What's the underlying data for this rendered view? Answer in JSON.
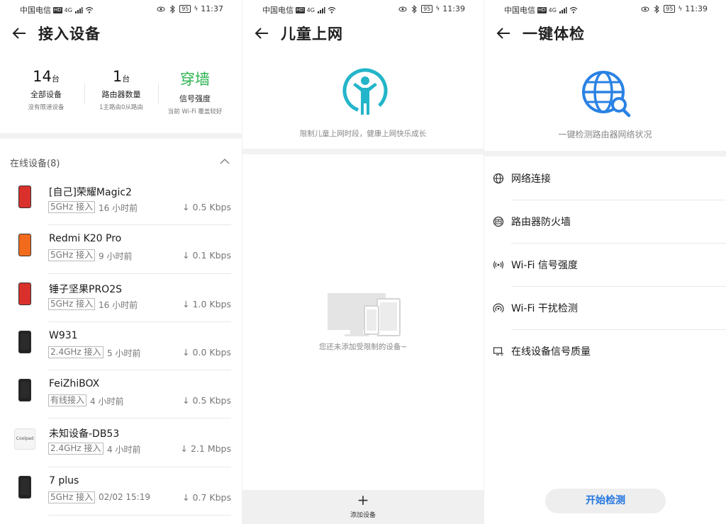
{
  "panels": {
    "devices": {
      "status": {
        "carrier": "中国电信",
        "hd": "HD",
        "signal": "4G",
        "battery": "95",
        "time": "11:37"
      },
      "title": "接入设备",
      "stats": [
        {
          "value": "14",
          "unit": "台",
          "label": "全部设备",
          "sub": "没有限速设备"
        },
        {
          "value": "1",
          "unit": "台",
          "label": "路由器数量",
          "sub": "1主路由0从路由"
        },
        {
          "value": "穿墙",
          "unit": "",
          "label": "信号强度",
          "sub": "当前 Wi-Fi 覆盖较好"
        }
      ],
      "online_header": "在线设备(8)",
      "devices": [
        {
          "name": "[自己]荣耀Magic2",
          "tag": "5GHz 接入",
          "time": "16 小时前",
          "rate": "↓ 0.5 Kbps",
          "icon": "huawei-phone",
          "color": "#d9302c"
        },
        {
          "name": "Redmi K20 Pro",
          "tag": "5GHz 接入",
          "time": "9 小时前",
          "rate": "↓ 0.1 Kbps",
          "icon": "mi-phone",
          "color": "#f26b1d"
        },
        {
          "name": "锤子坚果PRO2S",
          "tag": "5GHz 接入",
          "time": "16 小时前",
          "rate": "↓ 1.0 Kbps",
          "icon": "smartisan-phone",
          "color": "#d9302c"
        },
        {
          "name": "W931",
          "tag": "2.4GHz 接入",
          "time": "5 小时前",
          "rate": "↓ 0.0 Kbps",
          "icon": "black-phone",
          "color": "#222222"
        },
        {
          "name": "FeiZhiBOX",
          "tag": "有线接入",
          "time": "4 小时前",
          "rate": "↓ 0.5 Kbps",
          "icon": "black-phone",
          "color": "#222222"
        },
        {
          "name": "未知设备-DB53",
          "tag": "2.4GHz 接入",
          "time": "4 小时前",
          "rate": "↓ 2.1 Mbps",
          "icon": "coolpad-logo",
          "color": "#f5f5f5",
          "logo": "Coolpad"
        },
        {
          "name": "7 plus",
          "tag": "5GHz 接入",
          "time": "02/02 15:19",
          "rate": "↓ 0.7 Kbps",
          "icon": "black-phone",
          "color": "#222222"
        }
      ]
    },
    "kids": {
      "status": {
        "carrier": "中国电信",
        "hd": "HD",
        "signal": "4G",
        "battery": "95",
        "time": "11:39"
      },
      "title": "儿童上网",
      "desc": "限制儿童上网时段，健康上网快乐成长",
      "empty": "您还未添加受限制的设备~",
      "add": {
        "plus": "+",
        "label": "添加设备"
      },
      "accent": "#23b5c9"
    },
    "check": {
      "status": {
        "carrier": "中国电信",
        "hd": "HD",
        "signal": "4G",
        "battery": "95",
        "time": "11:39"
      },
      "title": "一键体检",
      "desc": "一键检测路由器网络状况",
      "items": [
        {
          "label": "网络连接",
          "icon": "globe-icon"
        },
        {
          "label": "路由器防火墙",
          "icon": "firewall-icon"
        },
        {
          "label": "Wi-Fi 信号强度",
          "icon": "wifi-strength-icon"
        },
        {
          "label": "Wi-Fi 干扰检测",
          "icon": "wifi-interference-icon"
        },
        {
          "label": "在线设备信号质量",
          "icon": "device-signal-icon"
        }
      ],
      "start": "开始检测",
      "accent": "#2a82e4"
    }
  }
}
